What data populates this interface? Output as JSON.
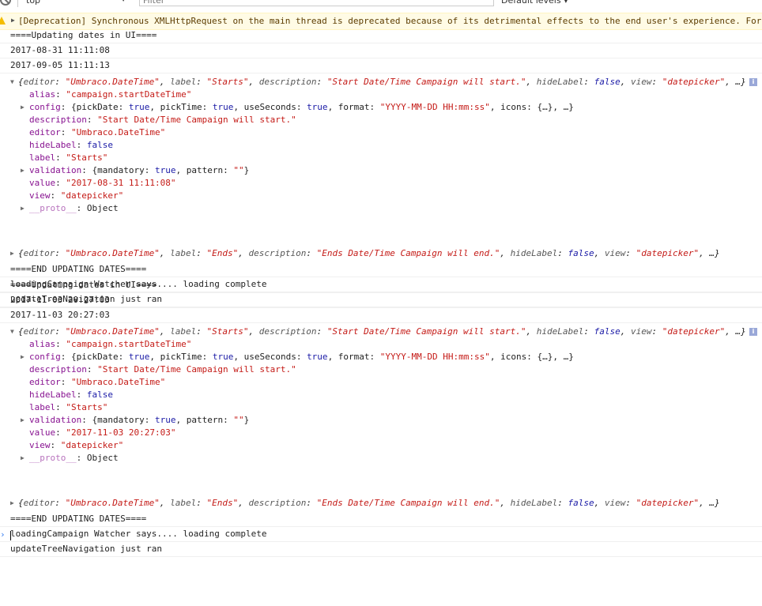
{
  "toolbar": {
    "context": "top",
    "filter_placeholder": "Filter",
    "levels": "Default levels ▾"
  },
  "warning": {
    "text": "[Deprecation] Synchronous XMLHttpRequest on the main thread is deprecated because of its detrimental effects to the end user's experience. For"
  },
  "blocks": [
    {
      "updating": "====Updating dates in UI====",
      "date1": "2017-08-31 11:11:08",
      "date2": "2017-09-05 11:11:13",
      "starts": {
        "editor": "\"Umbraco.DateTime\"",
        "label": "\"Starts\"",
        "description": "\"Start Date/Time Campaign will start.\"",
        "hideLabel": "false",
        "view": "\"datepicker\"",
        "alias": "\"campaign.startDateTime\"",
        "config_pickDate": "true",
        "config_pickTime": "true",
        "config_useSeconds": "true",
        "config_format": "\"YYYY-MM-DD HH:mm:ss\"",
        "validation_mandatory": "true",
        "validation_pattern": "\"\"",
        "value": "\"2017-08-31 11:11:08\"",
        "proto": "Object"
      },
      "ends": {
        "editor": "\"Umbraco.DateTime\"",
        "label": "\"Ends\"",
        "description": "\"Ends Date/Time Campaign will end.\"",
        "hideLabel": "false",
        "view": "\"datepicker\""
      },
      "end_updating": "====END UPDATING DATES====",
      "loading": "loadingCampaign Watcher says.... loading complete",
      "tree": "updateTreeNavigation just ran"
    },
    {
      "updating": "====Updating dates in UI====",
      "date1": "2017-11-03 20:27:03",
      "date2": "2017-11-03 20:27:03",
      "starts": {
        "editor": "\"Umbraco.DateTime\"",
        "label": "\"Starts\"",
        "description": "\"Start Date/Time Campaign will start.\"",
        "hideLabel": "false",
        "view": "\"datepicker\"",
        "alias": "\"campaign.startDateTime\"",
        "config_pickDate": "true",
        "config_pickTime": "true",
        "config_useSeconds": "true",
        "config_format": "\"YYYY-MM-DD HH:mm:ss\"",
        "validation_mandatory": "true",
        "validation_pattern": "\"\"",
        "value": "\"2017-11-03 20:27:03\"",
        "proto": "Object"
      },
      "ends": {
        "editor": "\"Umbraco.DateTime\"",
        "label": "\"Ends\"",
        "description": "\"Ends Date/Time Campaign will end.\"",
        "hideLabel": "false",
        "view": "\"datepicker\""
      },
      "end_updating": "====END UPDATING DATES====",
      "loading": "loadingCampaign Watcher says.... loading complete",
      "tree": "updateTreeNavigation just ran"
    }
  ],
  "colors": {
    "warning_bg": "#fffbe5",
    "warning_text": "#5c3c00",
    "key": "#881391",
    "string": "#c41a16",
    "keyword": "#1a1aa6",
    "prompt": "#367cf1"
  }
}
